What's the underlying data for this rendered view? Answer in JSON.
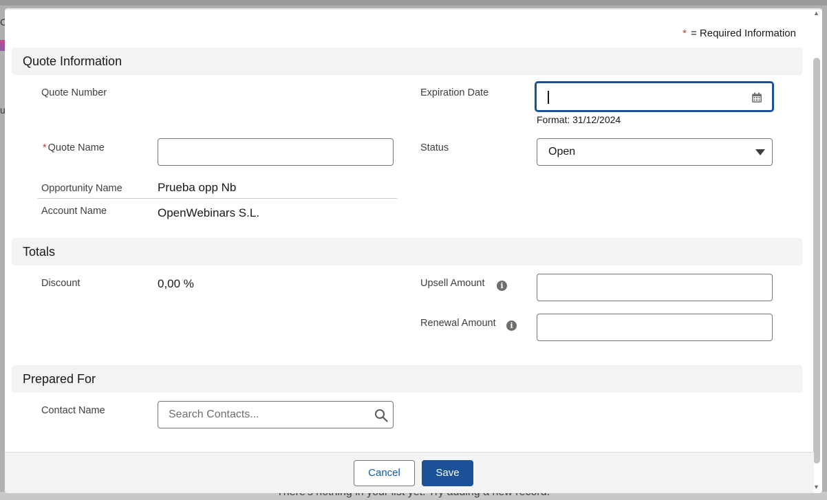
{
  "background": {
    "edge_letter_top": "C",
    "edge_letter_mid": "u",
    "footer_text": "There's nothing in your list yet. Try adding a new record."
  },
  "required_info": {
    "star": "*",
    "text": "= Required Information"
  },
  "sections": {
    "quote_information": "Quote Information",
    "totals": "Totals",
    "prepared_for": "Prepared For"
  },
  "fields": {
    "quote_number": {
      "label": "Quote Number"
    },
    "expiration_date": {
      "label": "Expiration Date",
      "value": "",
      "format_hint": "Format: 31/12/2024",
      "icon": "calendar-icon"
    },
    "quote_name": {
      "label": "Quote Name",
      "required_star": "*",
      "value": ""
    },
    "status": {
      "label": "Status",
      "value": "Open",
      "icon": "chevron-down-icon"
    },
    "opportunity_name": {
      "label": "Opportunity Name",
      "value": "Prueba opp Nb"
    },
    "account_name": {
      "label": "Account Name",
      "value": "OpenWebinars S.L."
    },
    "discount": {
      "label": "Discount",
      "value": "0,00 %"
    },
    "upsell_amount": {
      "label": "Upsell Amount",
      "value": "",
      "icon": "info-icon"
    },
    "renewal_amount": {
      "label": "Renewal Amount",
      "value": "",
      "icon": "info-icon"
    },
    "contact_name": {
      "label": "Contact Name",
      "placeholder": "Search Contacts...",
      "icon": "search-icon"
    }
  },
  "footer": {
    "cancel_label": "Cancel",
    "save_label": "Save"
  },
  "colors": {
    "brand": "#1b5297",
    "required": "#c23934",
    "section_bg": "#f3f3f3"
  }
}
